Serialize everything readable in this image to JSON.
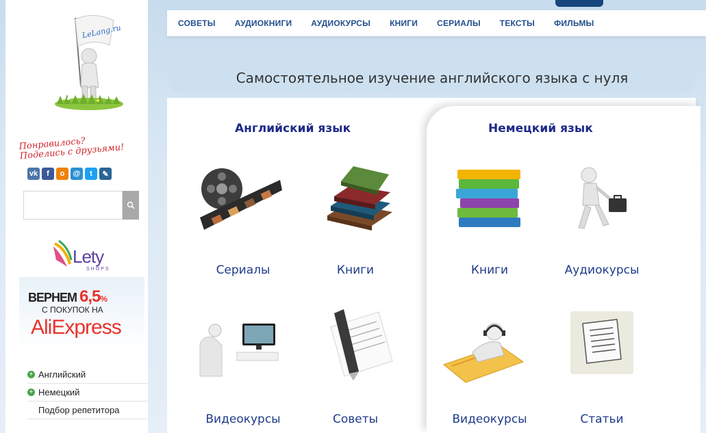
{
  "nav": [
    "СОВЕТЫ",
    "АУДИОКНИГИ",
    "АУДИОКУРСЫ",
    "КНИГИ",
    "СЕРИАЛЫ",
    "ТЕКСТЫ",
    "ФИЛЬМЫ"
  ],
  "logo_text": "LeLang.ru",
  "share_text": {
    "line1": "Понравилось?",
    "line2": "Поделись с друзьями!"
  },
  "social_icons": [
    {
      "name": "vk-icon",
      "glyph": "vk",
      "color": "#4a76a8"
    },
    {
      "name": "facebook-icon",
      "glyph": "f",
      "color": "#3b5998"
    },
    {
      "name": "odnoklassniki-icon",
      "glyph": "o",
      "color": "#ee8208"
    },
    {
      "name": "moimir-icon",
      "glyph": "@",
      "color": "#2a8fd4"
    },
    {
      "name": "twitter-icon",
      "glyph": "t",
      "color": "#1da1f2"
    },
    {
      "name": "livejournal-icon",
      "glyph": "✎",
      "color": "#2a6496"
    }
  ],
  "search": {
    "placeholder": ""
  },
  "ad": {
    "brand": "Lety",
    "brand_sub": "SHOPS",
    "line1_prefix": "ВЕРНЕМ ",
    "line1_num": "6,5",
    "line1_pct": "%",
    "line2": "С ПОКУПОК НА",
    "line3": "AliExpress"
  },
  "sidenav": {
    "items": [
      {
        "label": "Английский",
        "icon": "plus-circle-icon"
      },
      {
        "label": "Немецкий",
        "icon": "plus-circle-icon"
      },
      {
        "label": "Подбор репетитора"
      }
    ]
  },
  "page_title": "Самостоятельное изучение английского языка с нуля",
  "english": {
    "heading": "Английский язык",
    "tiles": [
      "Сериалы",
      "Книги",
      "Видеокурсы",
      "Советы"
    ]
  },
  "german": {
    "heading": "Немецкий язык",
    "tiles": [
      "Книги",
      "Аудиокурсы",
      "Видеокурсы",
      "Статьи"
    ]
  },
  "colors": {
    "accent": "#224f8c",
    "heading": "#1f2a88",
    "red": "#e9322d",
    "green": "#49a54a"
  }
}
